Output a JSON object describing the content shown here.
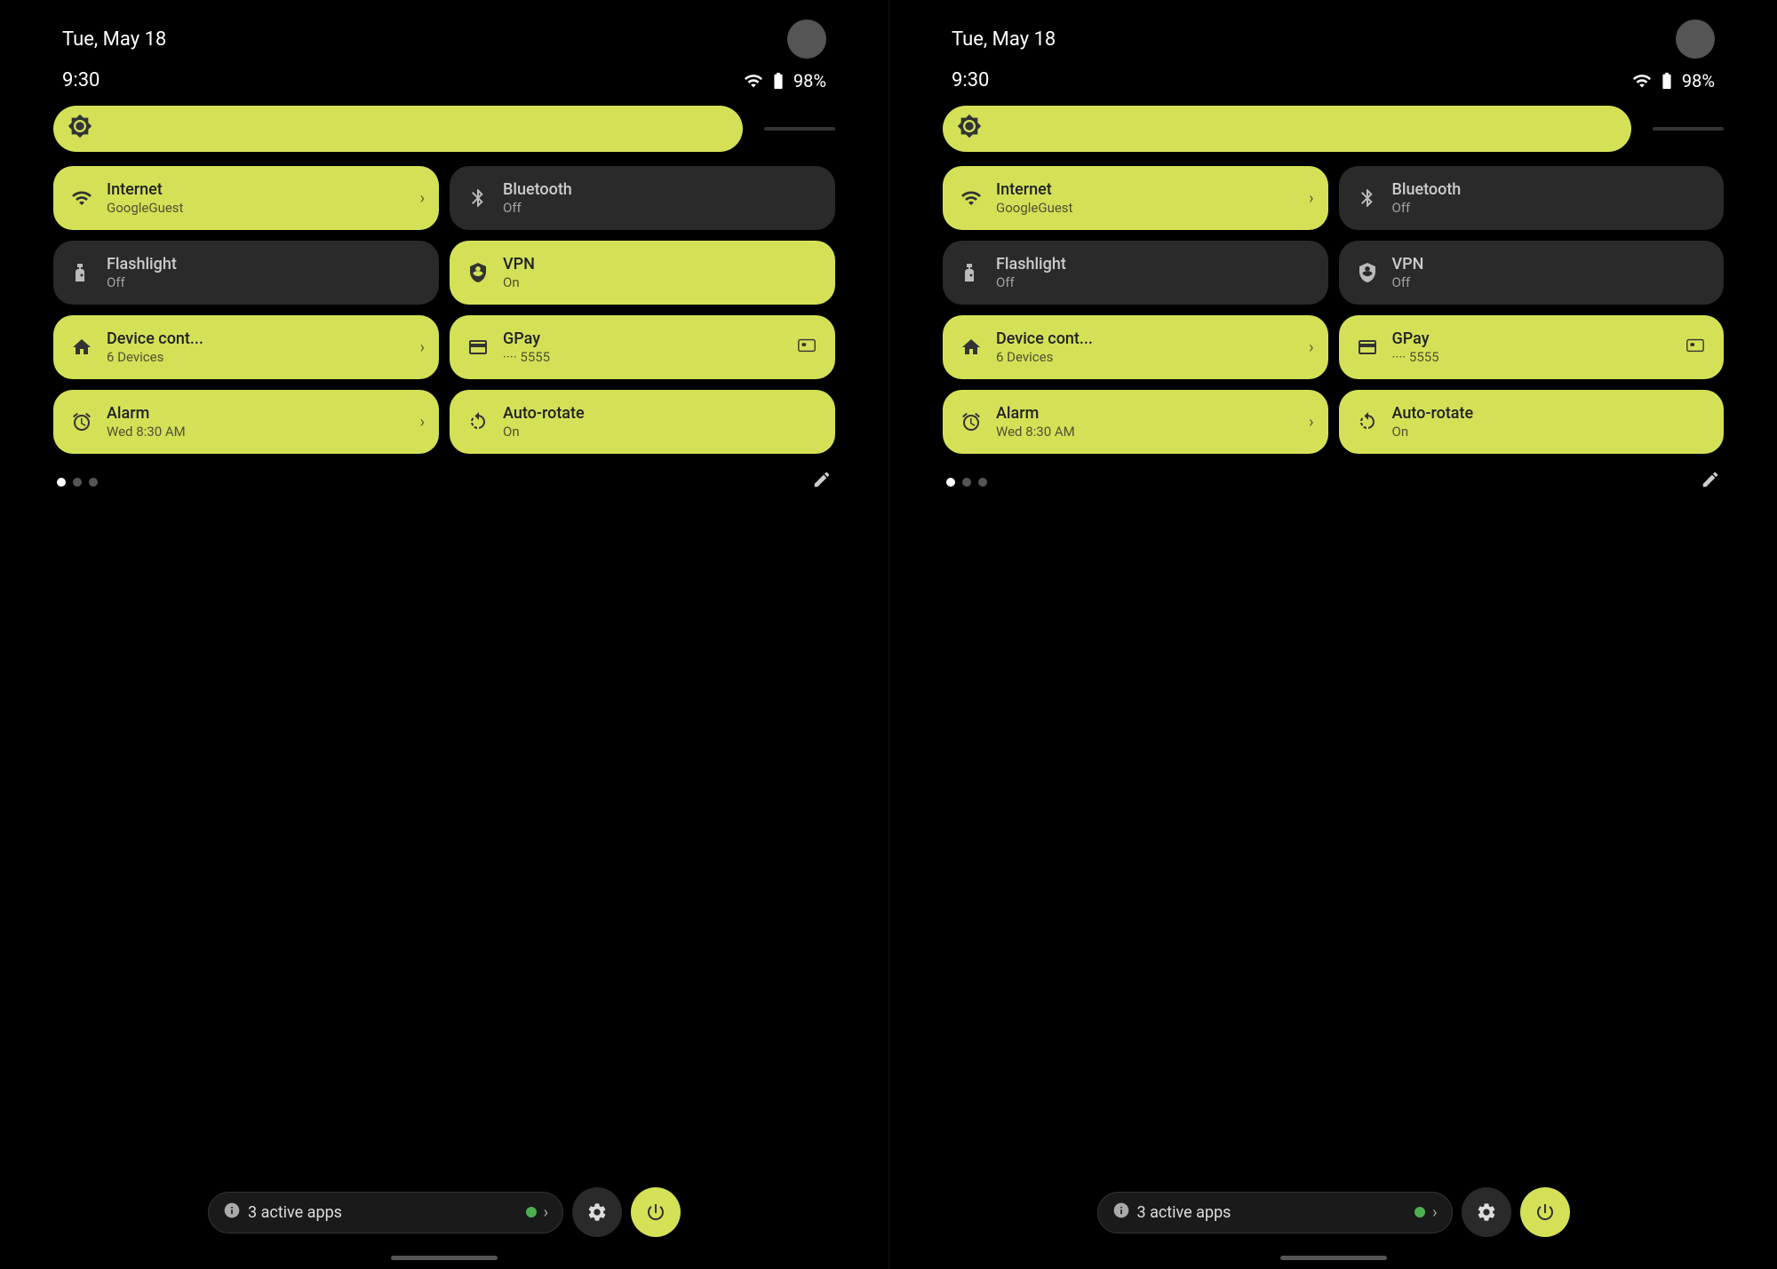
{
  "panels": [
    {
      "id": "panel-left",
      "status": {
        "date": "Tue, May 18",
        "time": "9:30",
        "battery": "98%"
      },
      "brightness": {
        "icon": "☀"
      },
      "tiles": [
        {
          "id": "internet",
          "icon": "wifi",
          "title": "Internet",
          "subtitle": "GoogleGuest",
          "state": "active",
          "hasChevron": true
        },
        {
          "id": "bluetooth",
          "icon": "bluetooth",
          "title": "Bluetooth",
          "subtitle": "Off",
          "state": "inactive",
          "hasChevron": false
        },
        {
          "id": "flashlight",
          "icon": "flashlight",
          "title": "Flashlight",
          "subtitle": "Off",
          "state": "inactive",
          "hasChevron": false
        },
        {
          "id": "vpn",
          "icon": "vpn",
          "title": "VPN",
          "subtitle": "On",
          "state": "active",
          "hasChevron": false
        },
        {
          "id": "device-control",
          "icon": "home",
          "title": "Device cont...",
          "subtitle": "6 Devices",
          "state": "active",
          "hasChevron": true
        },
        {
          "id": "gpay",
          "icon": "card",
          "title": "GPay",
          "subtitle": "···· 5555",
          "state": "active",
          "hasChevron": false,
          "hasCardIcon": true
        },
        {
          "id": "alarm",
          "icon": "alarm",
          "title": "Alarm",
          "subtitle": "Wed 8:30 AM",
          "state": "active",
          "hasChevron": true
        },
        {
          "id": "autorotate",
          "icon": "rotate",
          "title": "Auto-rotate",
          "subtitle": "On",
          "state": "active",
          "hasChevron": false
        }
      ],
      "dots": [
        true,
        false,
        false
      ],
      "activeApps": "3 active apps",
      "bottomButtons": {
        "gear": "⚙",
        "power": "⏻"
      }
    },
    {
      "id": "panel-right",
      "status": {
        "date": "Tue, May 18",
        "time": "9:30",
        "battery": "98%"
      },
      "brightness": {
        "icon": "☀"
      },
      "tiles": [
        {
          "id": "internet",
          "icon": "wifi",
          "title": "Internet",
          "subtitle": "GoogleGuest",
          "state": "active",
          "hasChevron": true
        },
        {
          "id": "bluetooth",
          "icon": "bluetooth",
          "title": "Bluetooth",
          "subtitle": "Off",
          "state": "inactive",
          "hasChevron": false
        },
        {
          "id": "flashlight",
          "icon": "flashlight",
          "title": "Flashlight",
          "subtitle": "Off",
          "state": "inactive",
          "hasChevron": false
        },
        {
          "id": "vpn",
          "icon": "vpn",
          "title": "VPN",
          "subtitle": "Off",
          "state": "inactive",
          "hasChevron": false
        },
        {
          "id": "device-control",
          "icon": "home",
          "title": "Device cont...",
          "subtitle": "6 Devices",
          "state": "active",
          "hasChevron": true
        },
        {
          "id": "gpay",
          "icon": "card",
          "title": "GPay",
          "subtitle": "···· 5555",
          "state": "active",
          "hasChevron": false,
          "hasCardIcon": true
        },
        {
          "id": "alarm",
          "icon": "alarm",
          "title": "Alarm",
          "subtitle": "Wed 8:30 AM",
          "state": "active",
          "hasChevron": true
        },
        {
          "id": "autorotate",
          "icon": "rotate",
          "title": "Auto-rotate",
          "subtitle": "On",
          "state": "active",
          "hasChevron": false
        }
      ],
      "dots": [
        true,
        false,
        false
      ],
      "activeApps": "3 active apps",
      "bottomButtons": {
        "gear": "⚙",
        "power": "⏻"
      }
    }
  ]
}
